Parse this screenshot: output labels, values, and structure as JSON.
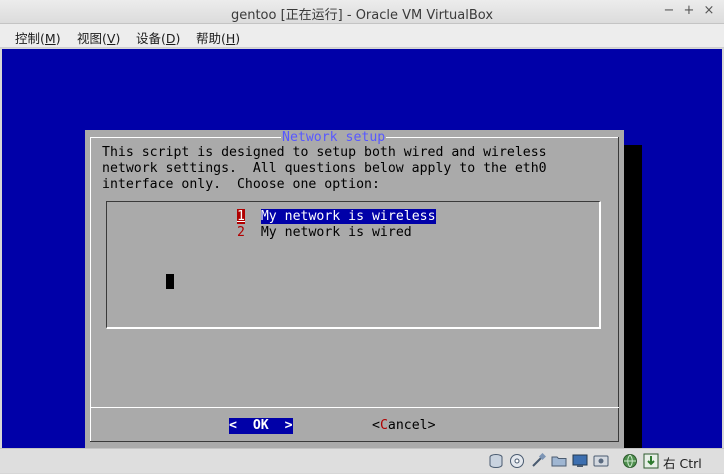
{
  "window": {
    "title": "gentoo [正在运行] - Oracle VM VirtualBox",
    "controls": [
      "−",
      "+",
      "×"
    ]
  },
  "menubar": {
    "items": [
      {
        "label": "控制(",
        "key": "M",
        "end": ")"
      },
      {
        "label": "视图(",
        "key": "V",
        "end": ")"
      },
      {
        "label": "设备(",
        "key": "D",
        "end": ")"
      },
      {
        "label": "帮助(",
        "key": "H",
        "end": ")"
      }
    ]
  },
  "dialog": {
    "title": "Network setup",
    "prompt": "This script is designed to setup both wired and wireless\nnetwork settings.  All questions below apply to the eth0\ninterface only.  Choose one option:",
    "options": [
      {
        "tag": "1",
        "label": "My network is wireless",
        "selected": true
      },
      {
        "tag": "2",
        "label": "My network is wired",
        "selected": false
      }
    ],
    "ok_label": "<  OK  >",
    "cancel": {
      "pre": "<",
      "hot": "C",
      "rest": "ancel>"
    }
  },
  "statusbar": {
    "icons": [
      "hard-disk-icon",
      "optical-disk-icon",
      "usb-icon",
      "shared-folder-icon",
      "display-icon",
      "video-capture-icon",
      "network-icon",
      "mouse-integration-icon"
    ],
    "host_key": "右 Ctrl"
  },
  "colors": {
    "vm_background": "#0000a8",
    "dialog_background": "#aaaaaa",
    "title_color": "#5858ff",
    "hotkey_red": "#b00000"
  }
}
